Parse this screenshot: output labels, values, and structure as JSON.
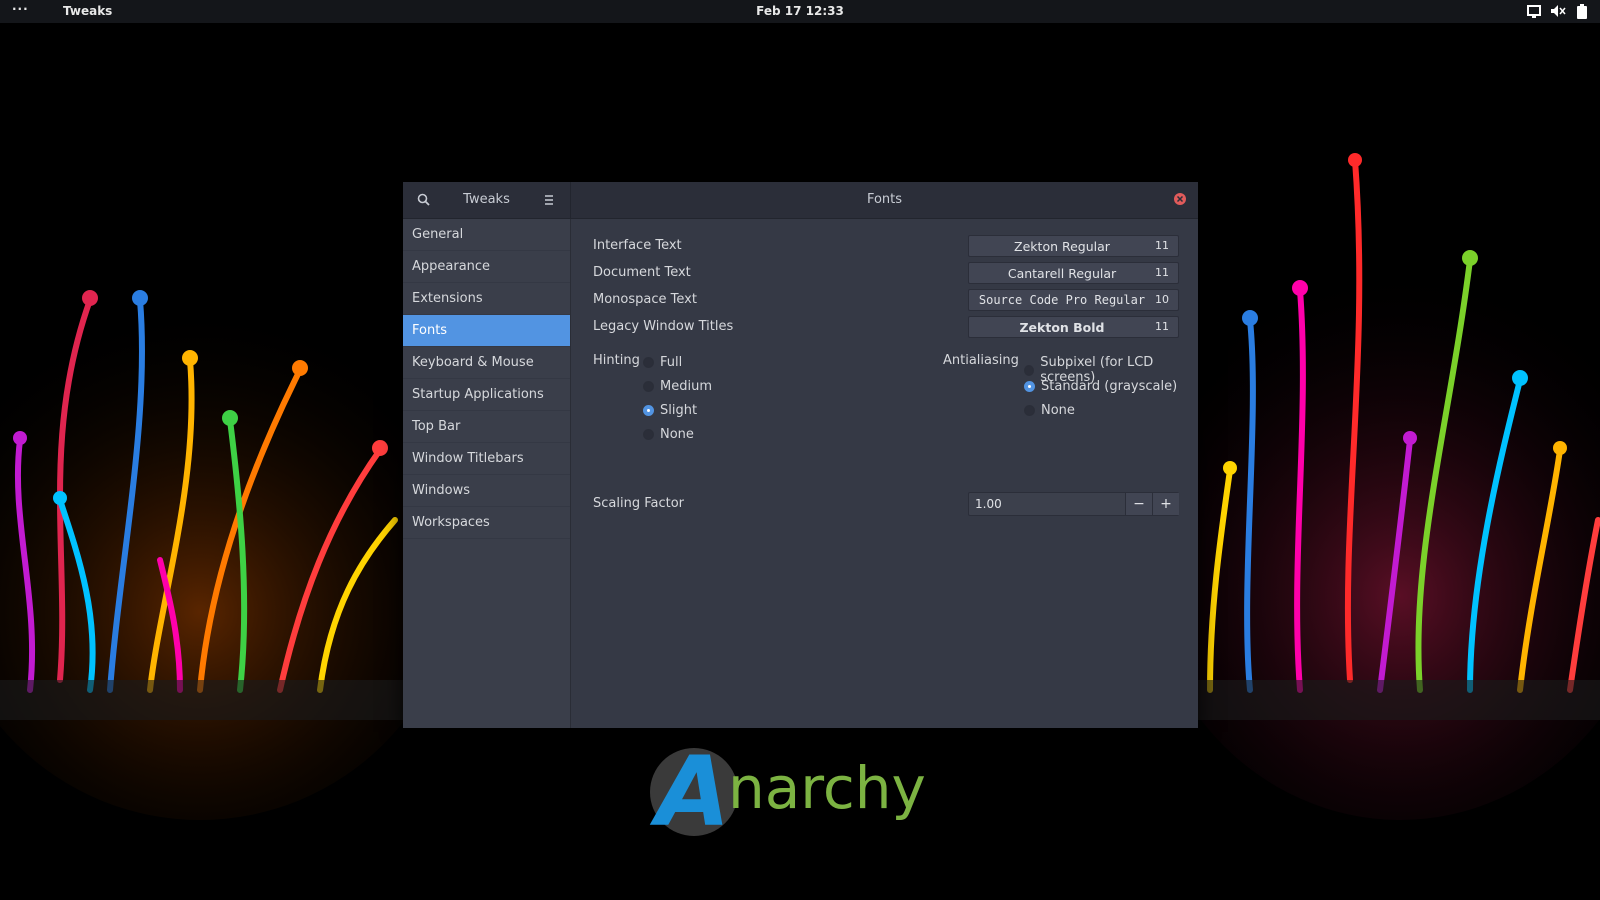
{
  "topbar": {
    "activities": "···",
    "app_name": "Tweaks",
    "datetime": "Feb 17  12:33"
  },
  "window": {
    "sidebar_title": "Tweaks",
    "panel_title": "Fonts"
  },
  "sidebar": {
    "items": [
      {
        "label": "General"
      },
      {
        "label": "Appearance"
      },
      {
        "label": "Extensions"
      },
      {
        "label": "Fonts"
      },
      {
        "label": "Keyboard & Mouse"
      },
      {
        "label": "Startup Applications"
      },
      {
        "label": "Top Bar"
      },
      {
        "label": "Window Titlebars"
      },
      {
        "label": "Windows"
      },
      {
        "label": "Workspaces"
      }
    ],
    "selected": "Fonts"
  },
  "fonts": {
    "interface": {
      "label": "Interface Text",
      "font": "Zekton Regular",
      "size": "11"
    },
    "document": {
      "label": "Document Text",
      "font": "Cantarell Regular",
      "size": "11"
    },
    "monospace": {
      "label": "Monospace Text",
      "font": "Source Code Pro Regular",
      "size": "10"
    },
    "legacy": {
      "label": "Legacy Window Titles",
      "font": "Zekton Bold",
      "size": "11"
    }
  },
  "hinting": {
    "label": "Hinting",
    "options": [
      "Full",
      "Medium",
      "Slight",
      "None"
    ],
    "selected": "Slight"
  },
  "antialiasing": {
    "label": "Antialiasing",
    "options": [
      "Subpixel (for LCD screens)",
      "Standard (grayscale)",
      "None"
    ],
    "selected": "Standard (grayscale)"
  },
  "scaling": {
    "label": "Scaling Factor",
    "value": "1.00",
    "minus": "−",
    "plus": "+"
  },
  "logo": {
    "prefix": "A",
    "suffix": "narchy"
  },
  "colors": {
    "accent": "#5294e2",
    "window_bg": "#353945",
    "sidebar_bg": "#3a3e4a",
    "headerbar_bg": "#2b2e39",
    "close": "#e15b5b",
    "logo_blue": "#1a8fd8",
    "logo_green": "#7cb342"
  }
}
